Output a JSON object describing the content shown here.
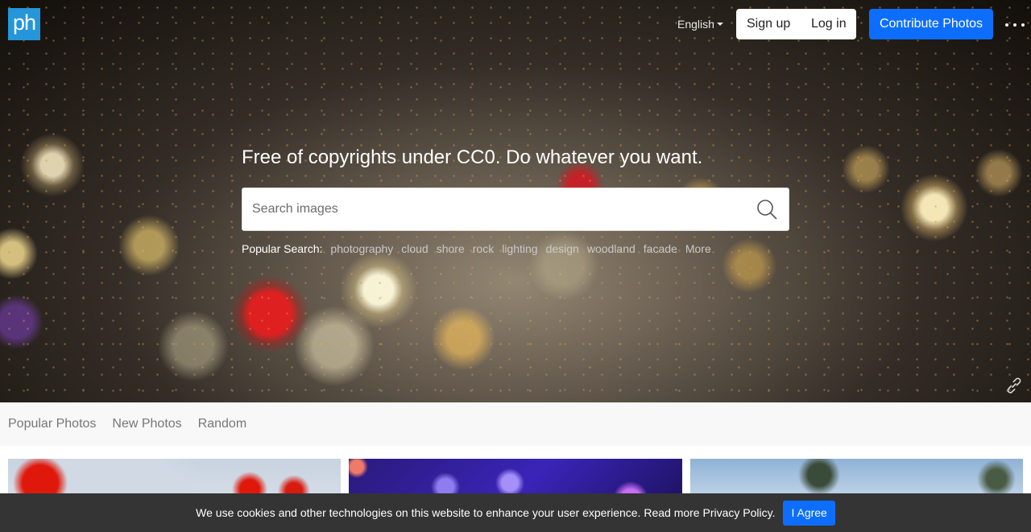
{
  "header": {
    "logo_text": "ph",
    "language": "English",
    "signup_label": "Sign up",
    "login_label": "Log in",
    "contribute_label": "Contribute Photos"
  },
  "hero": {
    "tagline": "Free of copyrights under CC0. Do whatever you want.",
    "search_placeholder": "Search images",
    "popular_label": "Popular Search:",
    "popular_tags": [
      "photography",
      "cloud",
      "shore",
      "rock",
      "lighting",
      "design",
      "woodland",
      "facade",
      "More"
    ]
  },
  "tabs": [
    "Popular Photos",
    "New Photos",
    "Random"
  ],
  "cookie": {
    "message": "We use cookies and other technologies on this website to enhance your user experience. Read more Privacy Policy.",
    "agree_label": "I Agree"
  },
  "colors": {
    "brand_logo": "#2596d9",
    "primary_button": "#0d6efd",
    "cookie_bar": "#343434",
    "tabs_bar": "#f8f8f8"
  },
  "icons": [
    "more-dots-icon",
    "search-icon",
    "link-icon",
    "caret-down-icon"
  ]
}
